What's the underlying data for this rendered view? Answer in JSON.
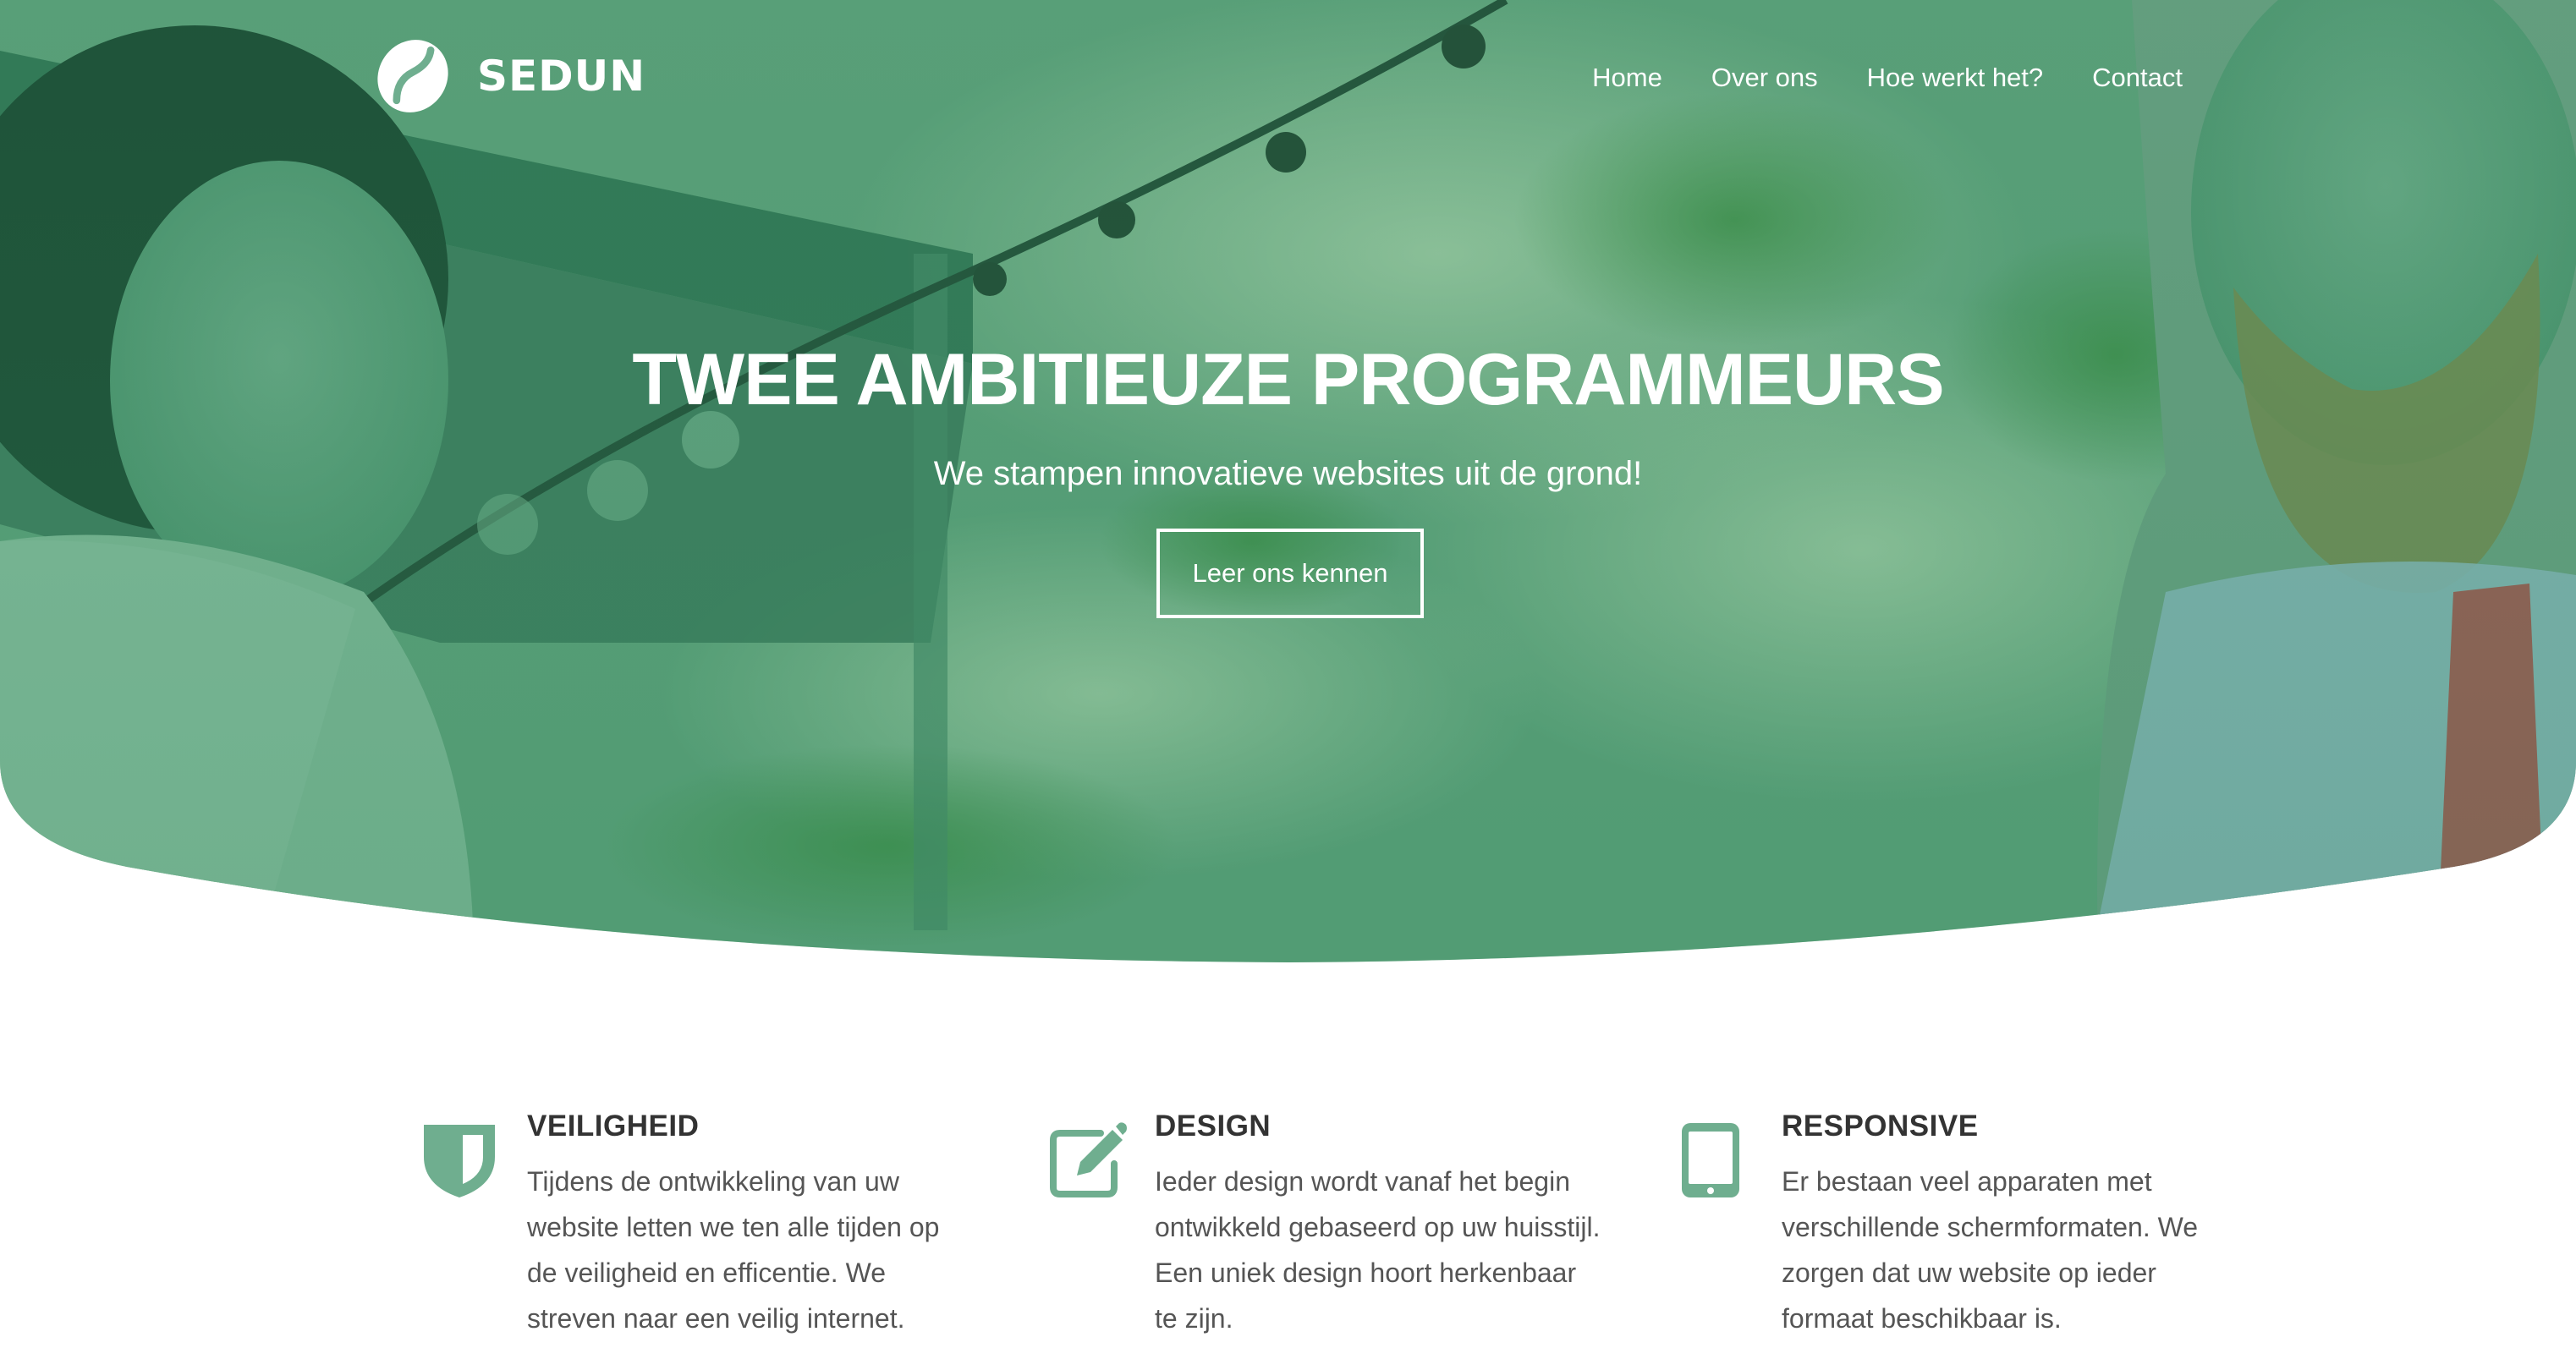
{
  "colors": {
    "brand_green": "#5aa67f",
    "icon_green": "#6fae8f",
    "text_dark": "#333333",
    "text_body": "#555555",
    "white": "#ffffff"
  },
  "header": {
    "logo": {
      "text": "SEDUN",
      "icon": "coffee-bean-icon"
    },
    "nav": [
      {
        "label": "Home"
      },
      {
        "label": "Over ons"
      },
      {
        "label": "Hoe werkt het?"
      },
      {
        "label": "Contact"
      }
    ]
  },
  "hero": {
    "title": "TWEE AMBITIEUZE PROGRAMMEURS",
    "subtitle": "We stampen innovatieve websites uit de grond!",
    "cta_label": "Leer ons kennen"
  },
  "features": [
    {
      "icon": "shield-icon",
      "title": "VEILIGHEID",
      "text": "Tijdens de ontwikkeling van uw website letten we ten alle tijden op de veiligheid en efficentie. We streven naar een veilig internet."
    },
    {
      "icon": "edit-pencil-icon",
      "title": "DESIGN",
      "text": "Ieder design wordt vanaf het begin ontwikkeld gebaseerd op uw huisstijl. Een uniek design hoort herkenbaar te zijn."
    },
    {
      "icon": "tablet-icon",
      "title": "RESPONSIVE",
      "text": "Er bestaan veel apparaten met verschillende schermformaten. We zorgen dat uw website op ieder formaat beschikbaar is."
    }
  ]
}
